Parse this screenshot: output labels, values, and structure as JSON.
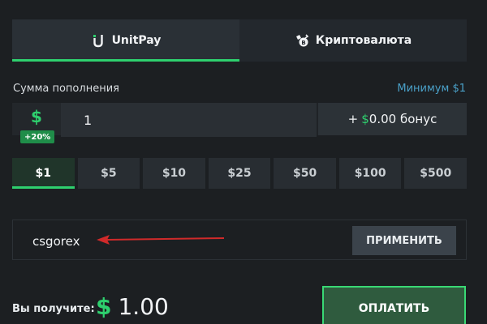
{
  "tabs": [
    {
      "label": "UnitPay",
      "icon": "unitpay-icon",
      "active": true
    },
    {
      "label": "Криптовалюта",
      "icon": "crypto-icon",
      "active": false
    }
  ],
  "amount": {
    "label": "Сумма пополнения",
    "minimum": "Минимум $1",
    "currency_sign": "$",
    "bonus_badge": "+20%",
    "value": "1",
    "bonus_prefix": "+",
    "bonus_currency": "$",
    "bonus_value": "0.00 бонус"
  },
  "presets": [
    {
      "label": "$1",
      "active": true
    },
    {
      "label": "$5",
      "active": false
    },
    {
      "label": "$10",
      "active": false
    },
    {
      "label": "$25",
      "active": false
    },
    {
      "label": "$50",
      "active": false
    },
    {
      "label": "$100",
      "active": false
    },
    {
      "label": "$500",
      "active": false
    }
  ],
  "promo": {
    "code": "csgorex",
    "apply_label": "ПРИМЕНИТЬ"
  },
  "footer": {
    "receive_label": "Вы получите:",
    "receive_currency": "$",
    "receive_value": "1.00",
    "pay_label": "ОПЛАТИТЬ"
  },
  "colors": {
    "accent": "#2ed06e",
    "background": "#1c1f22",
    "arrow": "#d02a2a",
    "link": "#4aa0c8"
  }
}
